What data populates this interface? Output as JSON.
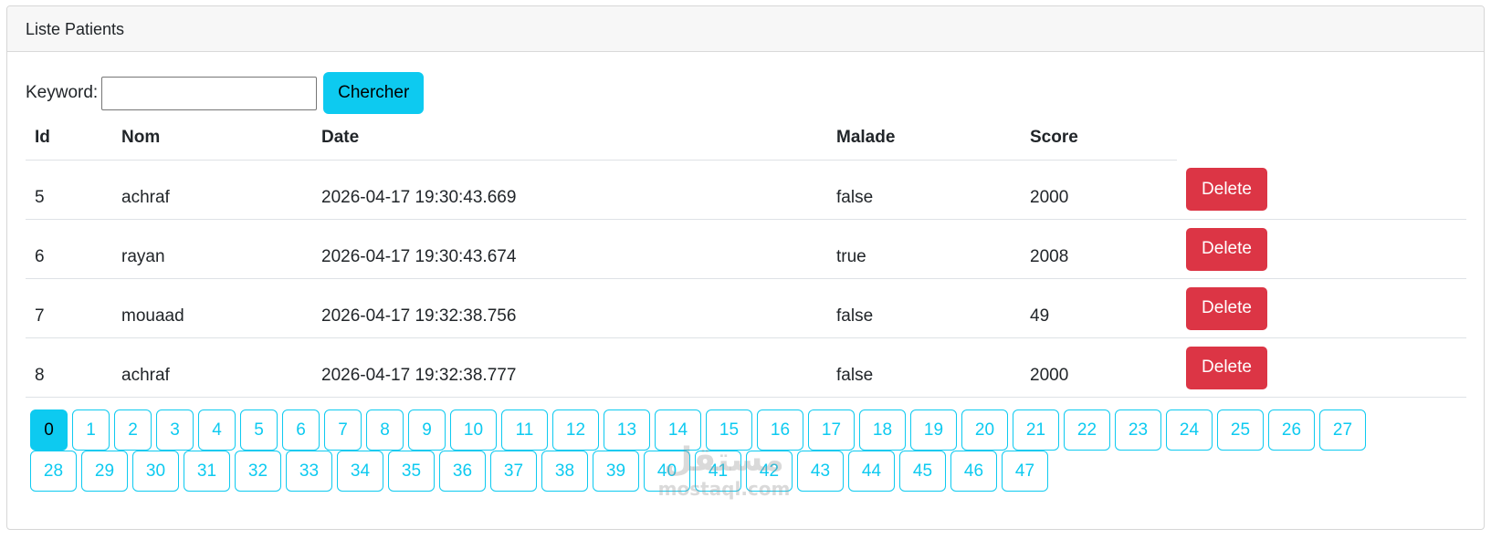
{
  "card": {
    "title": "Liste Patients"
  },
  "search": {
    "label": "Keyword:",
    "value": "",
    "placeholder": "",
    "button_label": "Chercher"
  },
  "table": {
    "headers": [
      "Id",
      "Nom",
      "Date",
      "Malade",
      "Score"
    ],
    "rows": [
      {
        "id": "5",
        "nom": "achraf",
        "date": "2026-04-17 19:30:43.669",
        "malade": "false",
        "score": "2000"
      },
      {
        "id": "6",
        "nom": "rayan",
        "date": "2026-04-17 19:30:43.674",
        "malade": "true",
        "score": "2008"
      },
      {
        "id": "7",
        "nom": "mouaad",
        "date": "2026-04-17 19:32:38.756",
        "malade": "false",
        "score": "49"
      },
      {
        "id": "8",
        "nom": "achraf",
        "date": "2026-04-17 19:32:38.777",
        "malade": "false",
        "score": "2000"
      }
    ],
    "delete_label": "Delete"
  },
  "pagination": {
    "current": "0",
    "pages": [
      "0",
      "1",
      "2",
      "3",
      "4",
      "5",
      "6",
      "7",
      "8",
      "9",
      "10",
      "11",
      "12",
      "13",
      "14",
      "15",
      "16",
      "17",
      "18",
      "19",
      "20",
      "21",
      "22",
      "23",
      "24",
      "25",
      "26",
      "27",
      "28",
      "29",
      "30",
      "31",
      "32",
      "33",
      "34",
      "35",
      "36",
      "37",
      "38",
      "39",
      "40",
      "41",
      "42",
      "43",
      "44",
      "45",
      "46",
      "47"
    ]
  },
  "watermark": {
    "logo": "مستقل",
    "text": "mostaql.com"
  },
  "colors": {
    "accent": "#0dcaf0",
    "danger": "#dc3545",
    "header_bg": "#f7f7f7"
  }
}
